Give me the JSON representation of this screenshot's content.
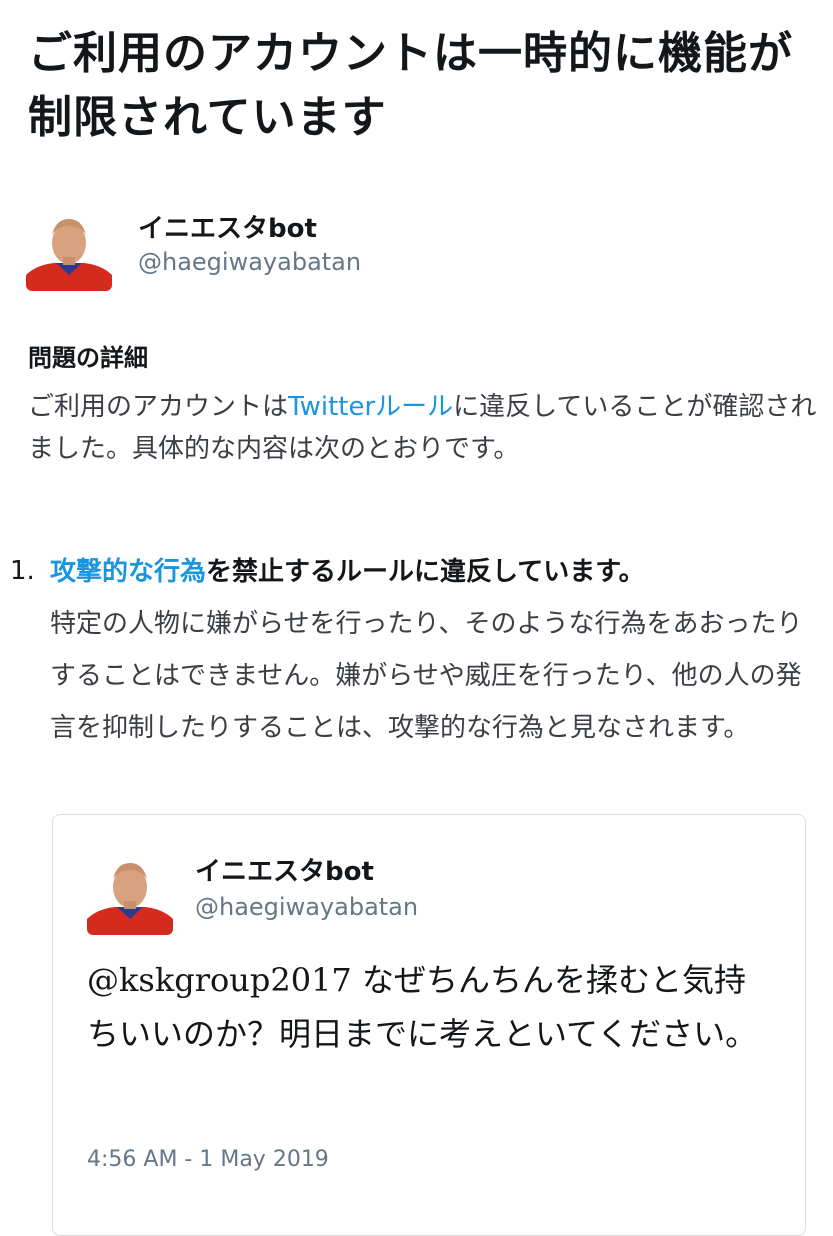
{
  "page": {
    "title": "ご利用のアカウントは一時的に機能が制限されています"
  },
  "account": {
    "name": "イニエスタbot",
    "handle": "@haegiwayabatan"
  },
  "details": {
    "heading": "問題の詳細",
    "text_before_link": "ご利用のアカウントは",
    "link_label": "Twitterルール",
    "text_after_link": "に違反していることが確認されました。具体的な内容は次のとおりです。"
  },
  "violations": [
    {
      "number": "1.",
      "link_label": "攻撃的な行為",
      "title_rest": "を禁止するルールに違反しています。",
      "body": "特定の人物に嫌がらせを行ったり、そのような行為をあおったりすることはできません。嫌がらせや威圧を行ったり、他の人の発言を抑制したりすることは、攻撃的な行為と見なされます。"
    }
  ],
  "tweet": {
    "author_name": "イニエスタbot",
    "author_handle": "@haegiwayabatan",
    "text": "@kskgroup2017 なぜちんちんを揉むと気持ちいいのか？明日までに考えといてください。",
    "timestamp": "4:56 AM - 1 May 2019"
  },
  "colors": {
    "link": "#1b95e0",
    "secondary_text": "#657786",
    "border": "#d9dee2",
    "avatar_jersey": "#d52b1e"
  },
  "icons": {
    "avatar": "profile-photo"
  }
}
